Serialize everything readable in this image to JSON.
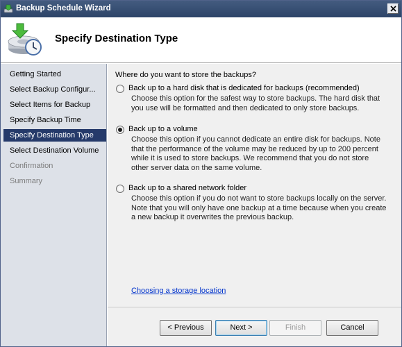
{
  "window": {
    "title": "Backup Schedule Wizard"
  },
  "header": {
    "title": "Specify Destination Type"
  },
  "sidebar": {
    "items": [
      {
        "label": "Getting Started"
      },
      {
        "label": "Select Backup Configur..."
      },
      {
        "label": "Select Items for Backup"
      },
      {
        "label": "Specify Backup Time"
      },
      {
        "label": "Specify Destination Type"
      },
      {
        "label": "Select Destination Volume"
      },
      {
        "label": "Confirmation"
      },
      {
        "label": "Summary"
      }
    ],
    "active_index": 4
  },
  "main": {
    "question": "Where do you want to store the backups?",
    "options": [
      {
        "label": "Back up to a hard disk that is dedicated for backups (recommended)",
        "description": "Choose this option for the safest way to store backups. The hard disk that you use will be formatted and then dedicated to only store backups.",
        "selected": false
      },
      {
        "label": "Back up to a volume",
        "description": "Choose this option if you cannot dedicate an entire disk for backups. Note that the performance of the volume may be reduced by up to 200 percent while it is used to store backups. We recommend that you do not store other server data on the same volume.",
        "selected": true
      },
      {
        "label": "Back up to a shared network folder",
        "description": "Choose this option if you do not want to store backups locally on the server. Note that you will only have one backup at a time because when you create a new backup it overwrites the previous backup.",
        "selected": false
      }
    ],
    "help_link": "Choosing a storage location"
  },
  "footer": {
    "previous": "< Previous",
    "next": "Next >",
    "finish": "Finish",
    "cancel": "Cancel"
  }
}
